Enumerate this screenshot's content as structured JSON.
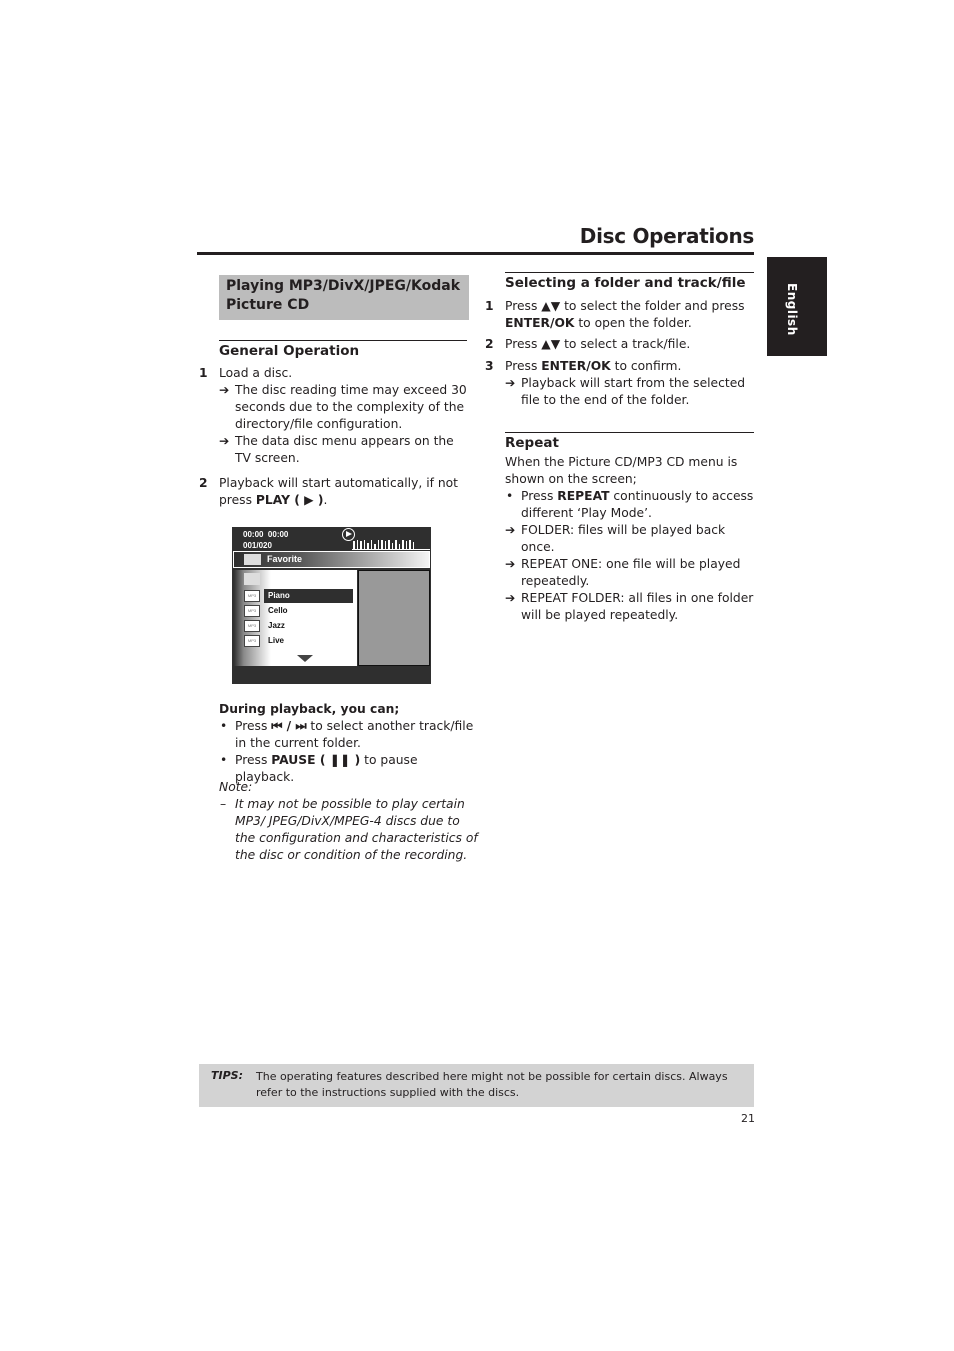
{
  "header": {
    "title": "Disc Operations",
    "language_tab": "English"
  },
  "left": {
    "section_title": "Playing MP3/DivX/JPEG/Kodak Picture CD",
    "general_heading": "General Operation",
    "steps": [
      {
        "num": "1",
        "text": "Load a disc.",
        "results": [
          "The disc reading time may exceed 30 seconds due to the complexity of the directory/file configuration.",
          "The data disc menu appears on the TV screen."
        ]
      },
      {
        "num": "2",
        "text_pre": "Playback will start automatically, if not press ",
        "text_bold": "PLAY ( ▶ )",
        "text_post": "."
      }
    ],
    "screen": {
      "time_elapsed": "00:00",
      "time_total": "00:00",
      "track_counter": "001/020",
      "play_icon": "play-circle-icon",
      "folder_name": "Favorite",
      "file_icon_label": "MP3",
      "files": [
        {
          "name": "Piano",
          "selected": true
        },
        {
          "name": "Cello",
          "selected": false
        },
        {
          "name": "Jazz",
          "selected": false
        },
        {
          "name": "Live",
          "selected": false
        }
      ]
    },
    "during_playback": {
      "heading": "During playback, you can;",
      "bullets": [
        {
          "pre": "Press ",
          "bold": "⏮ / ⏭",
          "post": " to select another track/file in the current folder."
        },
        {
          "pre": "Press ",
          "bold": "PAUSE ( ❚❚ )",
          "post": " to pause playback."
        }
      ]
    },
    "note": {
      "label": "Note:",
      "text": "It may not be possible to play certain MP3/ JPEG/DivX/MPEG-4 discs due to the configuration and characteristics of the disc or condition of the recording."
    }
  },
  "right": {
    "select_heading": "Selecting a folder and track/file",
    "select_steps": [
      {
        "num": "1",
        "pre": "Press ▲▼ to select the folder and press ",
        "bold": "ENTER/OK",
        "post": " to open the folder."
      },
      {
        "num": "2",
        "pre": "Press ▲▼ to select a track/file.",
        "bold": "",
        "post": ""
      },
      {
        "num": "3",
        "pre": "Press ",
        "bold": "ENTER/OK",
        "post": " to confirm.",
        "result": "Playback will start from the selected file to the end of the folder."
      }
    ],
    "repeat_heading": "Repeat",
    "repeat_intro": "When the Picture CD/MP3 CD menu is shown on the screen;",
    "repeat_bullet": {
      "pre": "Press ",
      "bold": "REPEAT",
      "post": " continuously to access different ‘Play Mode’."
    },
    "repeat_results": [
      "FOLDER: files will be played back once.",
      "REPEAT ONE: one file will be played repeatedly.",
      "REPEAT FOLDER: all files in one folder will be played repeatedly."
    ]
  },
  "tips": {
    "label": "TIPS:",
    "text": "The operating features described here might not be possible for certain discs. Always refer to the instructions supplied with the discs."
  },
  "page_number": "21",
  "symbols": {
    "arrow": "➔",
    "bullet": "•",
    "dash": "–"
  }
}
